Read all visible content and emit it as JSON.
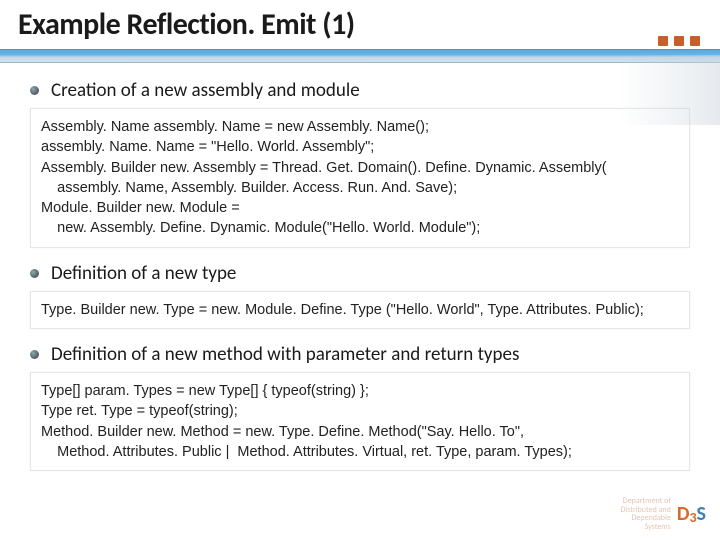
{
  "title": "Example Reflection. Emit (1)",
  "sections": [
    {
      "heading": "Creation of a new assembly and module",
      "code": [
        "Assembly. Name assembly. Name = new Assembly. Name();",
        "assembly. Name. Name = \"Hello. World. Assembly\";",
        "Assembly. Builder new. Assembly = Thread. Get. Domain(). Define. Dynamic. Assembly(",
        "    assembly. Name, Assembly. Builder. Access. Run. And. Save);",
        "Module. Builder new. Module =",
        "    new. Assembly. Define. Dynamic. Module(\"Hello. World. Module\");"
      ]
    },
    {
      "heading": "Definition of a new type",
      "code": [
        "Type. Builder new. Type = new. Module. Define. Type (\"Hello. World\", Type. Attributes. Public);"
      ]
    },
    {
      "heading": "Definition of a new method with parameter and return types",
      "code": [
        "Type[] param. Types = new Type[] { typeof(string) };",
        "Type ret. Type = typeof(string);",
        "Method. Builder new. Method = new. Type. Define. Method(\"Say. Hello. To\",",
        "    Method. Attributes. Public |  Method. Attributes. Virtual, ret. Type, param. Types);"
      ]
    }
  ],
  "footer": {
    "dept_lines": [
      "Department of",
      "Distributed and",
      "Dependable",
      "Systems"
    ],
    "logo": {
      "d": "D",
      "n3": "3",
      "s": "S"
    }
  }
}
